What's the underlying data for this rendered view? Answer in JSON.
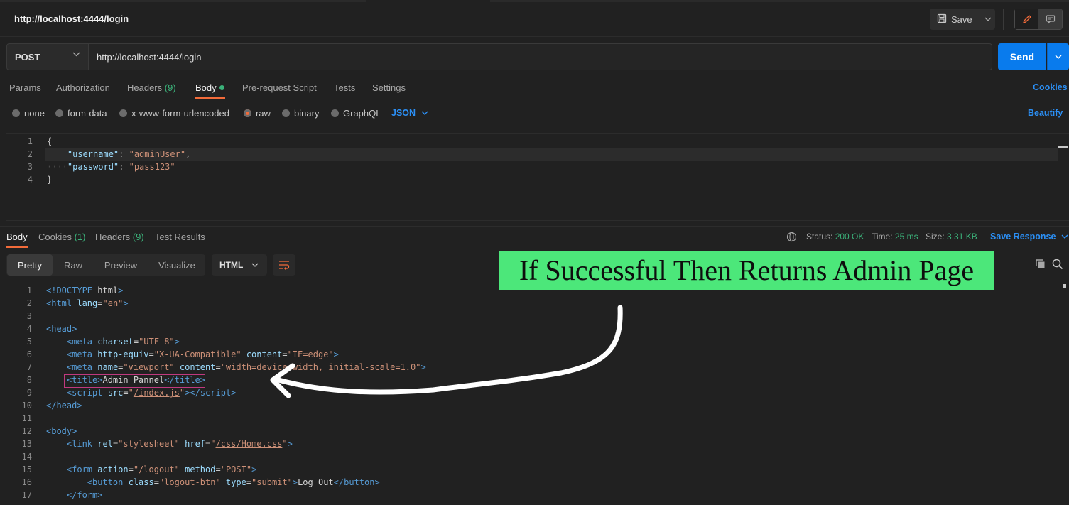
{
  "header": {
    "title": "http://localhost:4444/login",
    "save_label": "Save"
  },
  "request": {
    "method": "POST",
    "url": "http://localhost:4444/login",
    "send_label": "Send",
    "tabs": {
      "params": "Params",
      "authorization": "Authorization",
      "headers": "Headers",
      "headers_count": "(9)",
      "body": "Body",
      "prerequest": "Pre-request Script",
      "tests": "Tests",
      "settings": "Settings"
    },
    "cookies_label": "Cookies",
    "body_types": {
      "none": "none",
      "form_data": "form-data",
      "urlencoded": "x-www-form-urlencoded",
      "raw": "raw",
      "binary": "binary",
      "graphql": "GraphQL"
    },
    "language": "JSON",
    "beautify_label": "Beautify",
    "code_lines": [
      {
        "n": "1",
        "open": "{"
      },
      {
        "n": "2",
        "key": "\"username\"",
        "sep": ": ",
        "value": "\"adminUser\"",
        "trail": ","
      },
      {
        "n": "3",
        "key": "\"password\"",
        "sep": ": ",
        "value": "\"pass123\"",
        "trail": ""
      },
      {
        "n": "4",
        "close": "}"
      }
    ]
  },
  "response": {
    "tabs": {
      "body": "Body",
      "cookies": "Cookies",
      "cookies_count": "(1)",
      "headers": "Headers",
      "headers_count": "(9)",
      "test_results": "Test Results"
    },
    "status_label": "Status:",
    "status_value": "200 OK",
    "time_label": "Time:",
    "time_value": "25 ms",
    "size_label": "Size:",
    "size_value": "3.31 KB",
    "save_response_label": "Save Response",
    "views": {
      "pretty": "Pretty",
      "raw": "Raw",
      "preview": "Preview",
      "visualize": "Visualize"
    },
    "format": "HTML",
    "line_numbers": [
      "1",
      "2",
      "3",
      "4",
      "5",
      "6",
      "7",
      "8",
      "9",
      "10",
      "11",
      "12",
      "13",
      "14",
      "15",
      "16",
      "17"
    ]
  },
  "annotation": {
    "text": "If Successful Then Returns Admin Page",
    "color": "#4ce77a"
  },
  "colors": {
    "accent_blue": "#097bed",
    "tab_active": "#f26b3a",
    "success_green": "#3bb27a"
  }
}
